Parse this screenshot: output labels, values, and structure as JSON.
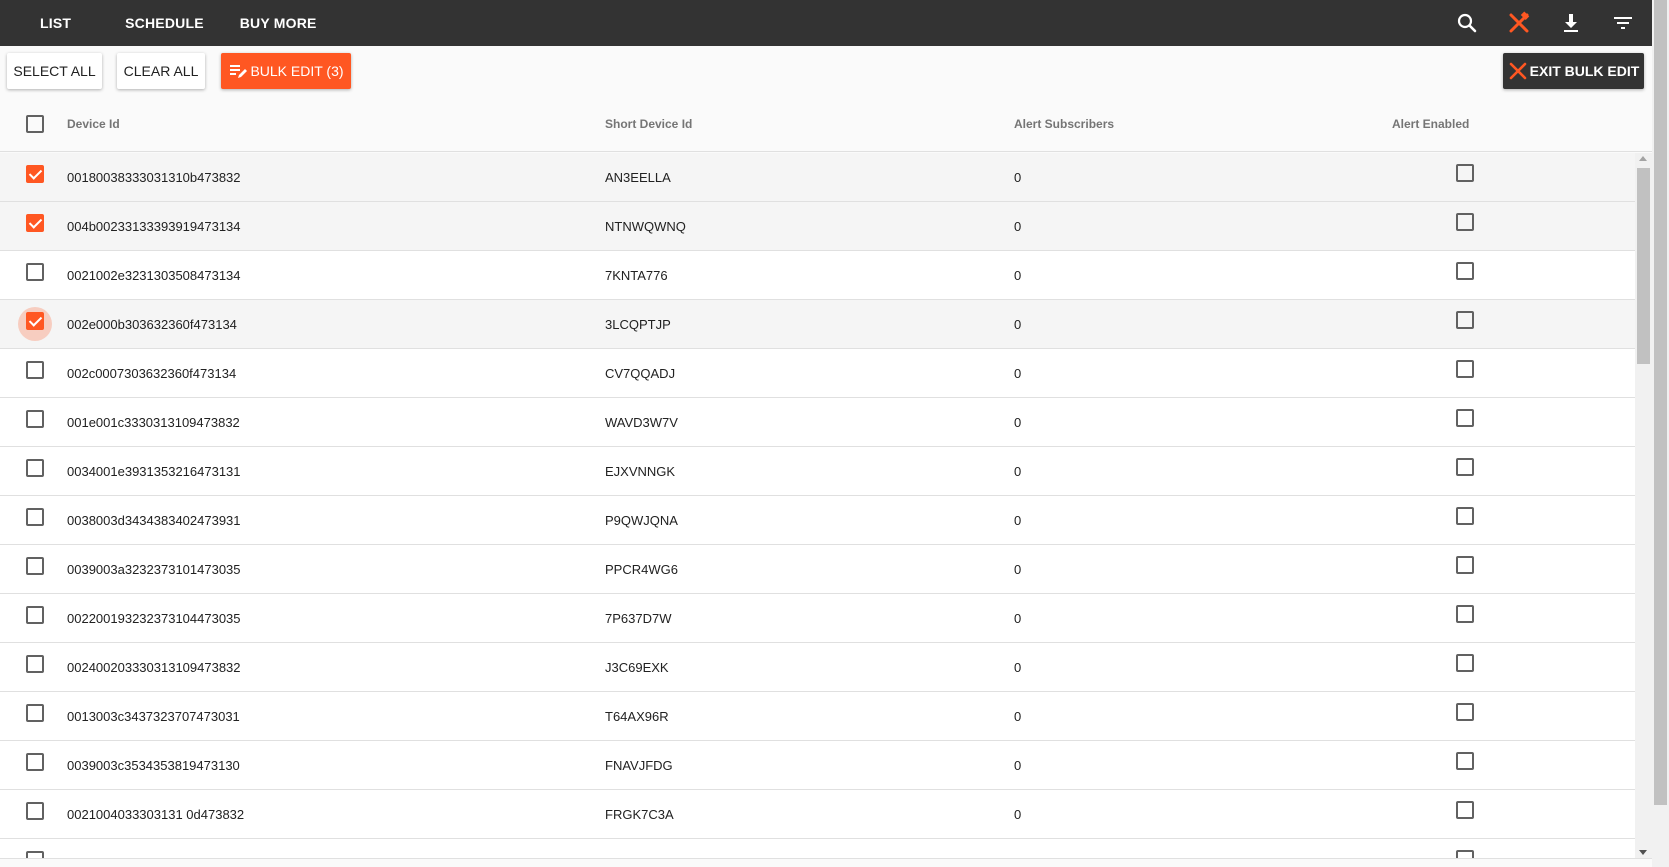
{
  "nav": {
    "items": [
      {
        "label": "LIST"
      },
      {
        "label": "SCHEDULE"
      },
      {
        "label": "BUY MORE"
      }
    ],
    "icons": [
      "search-icon",
      "bulk-edit-tools-icon",
      "download-icon",
      "filter-icon"
    ],
    "active_icon_color": "#ff5722"
  },
  "toolbar": {
    "select_all_label": "SELECT ALL",
    "clear_all_label": "CLEAR ALL",
    "bulk_edit_label": "BULK EDIT (3)",
    "exit_bulk_edit_label": "EXIT BULK EDIT"
  },
  "table": {
    "columns": [
      "Device Id",
      "Short Device Id",
      "Alert Subscribers",
      "Alert Enabled"
    ],
    "rows": [
      {
        "device_id": "00180038333031310b473832",
        "short_id": "AN3EELLA",
        "subscribers": "0",
        "selected": true,
        "alert_enabled": false
      },
      {
        "device_id": "004b00233133393919473134",
        "short_id": "NTNWQWNQ",
        "subscribers": "0",
        "selected": true,
        "alert_enabled": false
      },
      {
        "device_id": "0021002e3231303508473134",
        "short_id": "7KNTA776",
        "subscribers": "0",
        "selected": false,
        "alert_enabled": false
      },
      {
        "device_id": "002e000b303632360f473134",
        "short_id": "3LCQPTJP",
        "subscribers": "0",
        "selected": true,
        "alert_enabled": false
      },
      {
        "device_id": "002c0007303632360f473134",
        "short_id": "CV7QQADJ",
        "subscribers": "0",
        "selected": false,
        "alert_enabled": false
      },
      {
        "device_id": "001e001c3330313109473832",
        "short_id": "WAVD3W7V",
        "subscribers": "0",
        "selected": false,
        "alert_enabled": false
      },
      {
        "device_id": "0034001e3931353216473131",
        "short_id": "EJXVNNGK",
        "subscribers": "0",
        "selected": false,
        "alert_enabled": false
      },
      {
        "device_id": "0038003d3434383402473931",
        "short_id": "P9QWJQNA",
        "subscribers": "0",
        "selected": false,
        "alert_enabled": false
      },
      {
        "device_id": "0039003a3232373101473035",
        "short_id": "PPCR4WG6",
        "subscribers": "0",
        "selected": false,
        "alert_enabled": false
      },
      {
        "device_id": "002200193232373104473035",
        "short_id": "7P637D7W",
        "subscribers": "0",
        "selected": false,
        "alert_enabled": false
      },
      {
        "device_id": "002400203330313109473832",
        "short_id": "J3C69EXK",
        "subscribers": "0",
        "selected": false,
        "alert_enabled": false
      },
      {
        "device_id": "0013003c3437323707473031",
        "short_id": "T64AX96R",
        "subscribers": "0",
        "selected": false,
        "alert_enabled": false
      },
      {
        "device_id": "0039003c3534353819473130",
        "short_id": "FNAVJFDG",
        "subscribers": "0",
        "selected": false,
        "alert_enabled": false
      },
      {
        "device_id": "0021004033303131 0d473832",
        "short_id": "FRGK7C3A",
        "subscribers": "0",
        "selected": false,
        "alert_enabled": false
      }
    ]
  },
  "colors": {
    "accent": "#ff5722",
    "topbar": "#333333",
    "exit_button": "#333333"
  }
}
